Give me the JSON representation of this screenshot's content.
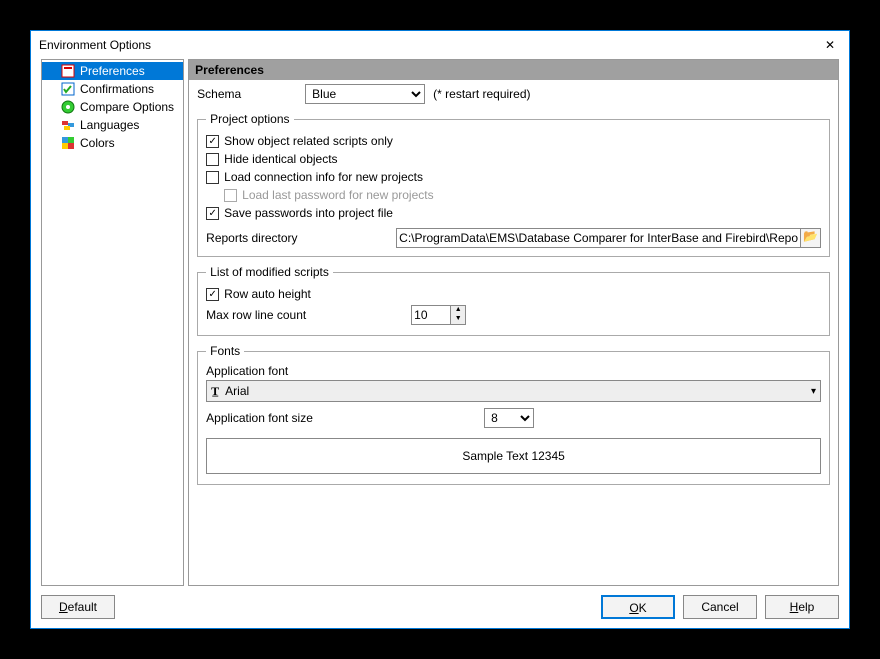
{
  "window": {
    "title": "Environment Options"
  },
  "tree": {
    "items": [
      {
        "label": "Preferences",
        "selected": true
      },
      {
        "label": "Confirmations"
      },
      {
        "label": "Compare Options"
      },
      {
        "label": "Languages"
      },
      {
        "label": "Colors"
      }
    ]
  },
  "panel": {
    "header": "Preferences",
    "schema_label": "Schema",
    "schema_value": "Blue",
    "schema_note": "(* restart required)",
    "project_options": {
      "legend": "Project options",
      "show_scripts": "Show object related scripts only",
      "hide_identical": "Hide identical objects",
      "load_conn": "Load connection info for new projects",
      "load_pwd": "Load last password for new projects",
      "save_pwd": "Save passwords into project file",
      "reports_label": "Reports directory",
      "reports_value": "C:\\ProgramData\\EMS\\Database Comparer for InterBase and Firebird\\Repo"
    },
    "scripts": {
      "legend": "List of modified scripts",
      "row_auto": "Row auto height",
      "max_row_label": "Max row line count",
      "max_row_value": "10"
    },
    "fonts": {
      "legend": "Fonts",
      "app_font_label": "Application font",
      "app_font_value": "Arial",
      "app_font_size_label": "Application font size",
      "app_font_size_value": "8",
      "sample": "Sample Text 12345"
    }
  },
  "buttons": {
    "default": "Default",
    "ok": "OK",
    "cancel": "Cancel",
    "help": "Help"
  }
}
